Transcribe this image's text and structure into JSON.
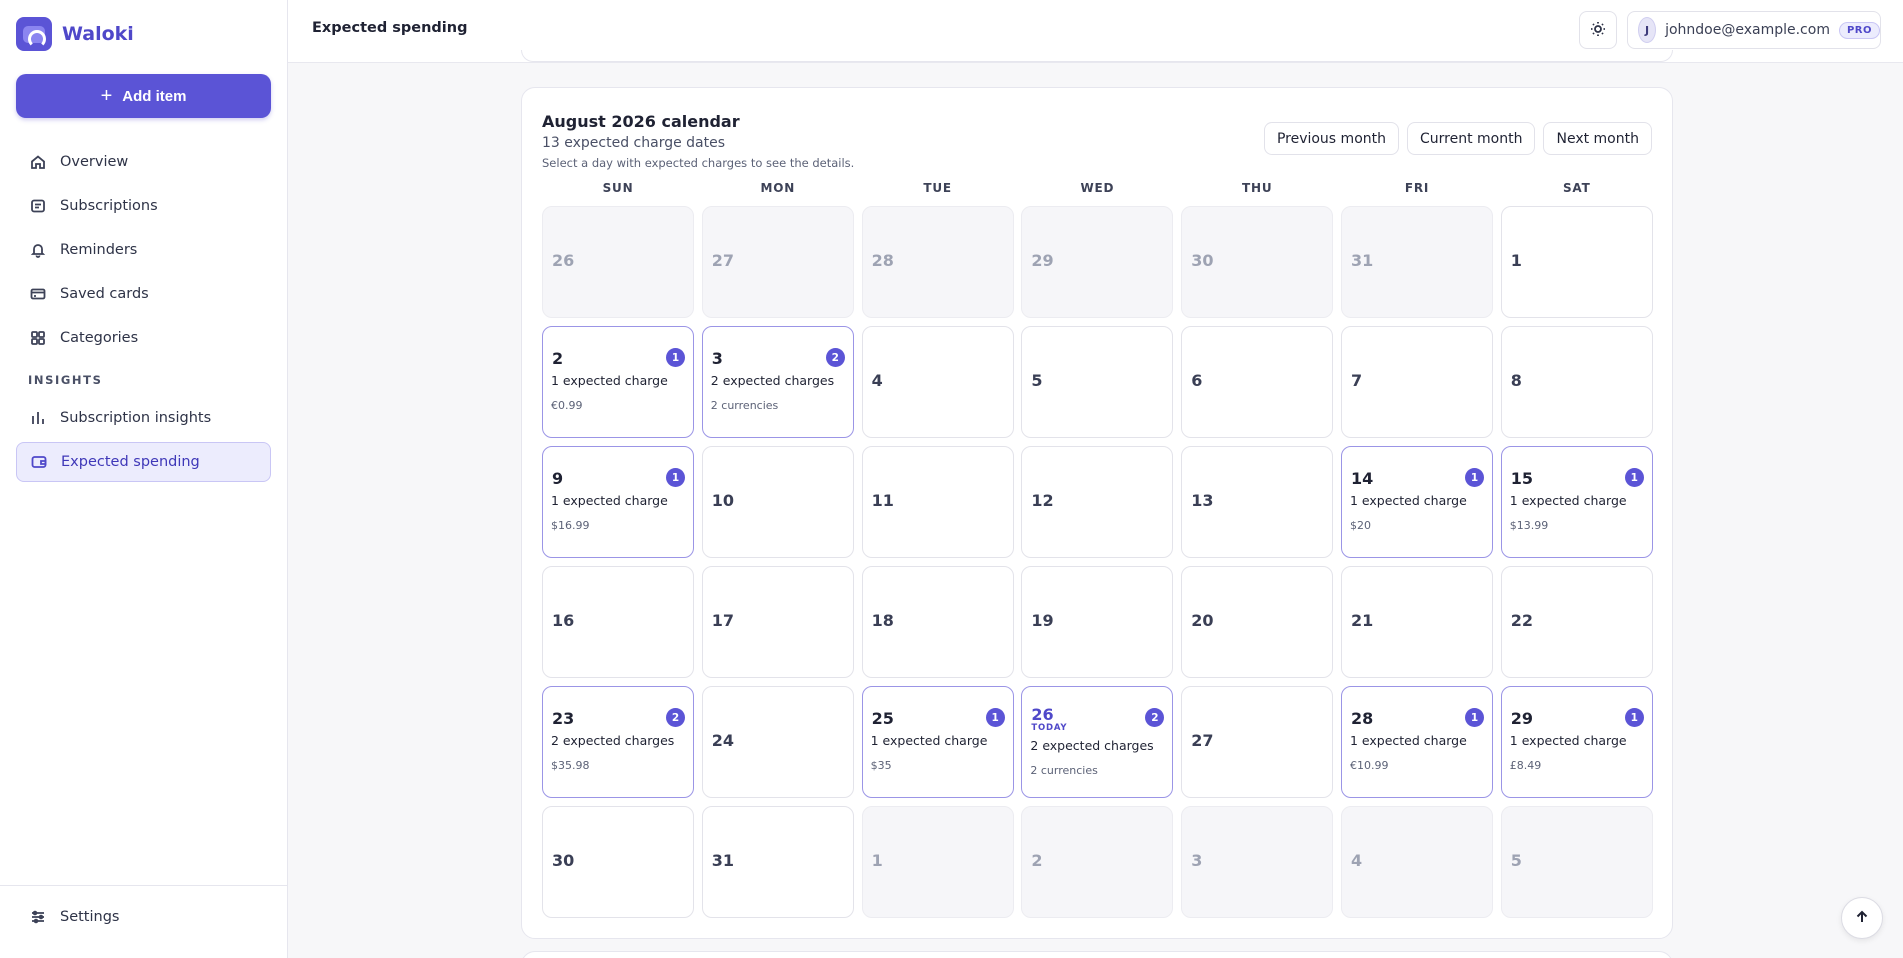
{
  "app": {
    "name": "Waloki"
  },
  "sidebar": {
    "add_label": "Add item",
    "items": [
      {
        "label": "Overview",
        "icon": "home-icon"
      },
      {
        "label": "Subscriptions",
        "icon": "list-icon"
      },
      {
        "label": "Reminders",
        "icon": "bell-icon"
      },
      {
        "label": "Saved cards",
        "icon": "card-icon"
      },
      {
        "label": "Categories",
        "icon": "grid-icon"
      }
    ],
    "section_label": "INSIGHTS",
    "insights": [
      {
        "label": "Subscription insights",
        "icon": "bar-chart-icon"
      },
      {
        "label": "Expected spending",
        "icon": "wallet-icon",
        "active": true
      }
    ],
    "settings_label": "Settings"
  },
  "header": {
    "title": "Expected spending",
    "user_initial": "J",
    "user_email": "johndoe@example.com",
    "plan_badge": "PRO"
  },
  "calendar": {
    "title": "August 2026 calendar",
    "subtitle": "13 expected charge dates",
    "hint": "Select a day with expected charges to see the details.",
    "buttons": {
      "previous": "Previous month",
      "current": "Current month",
      "next": "Next month"
    },
    "weekdays": [
      "SUN",
      "MON",
      "TUE",
      "WED",
      "THU",
      "FRI",
      "SAT"
    ],
    "today_label": "TODAY",
    "days": [
      {
        "day": "26",
        "outside": true
      },
      {
        "day": "27",
        "outside": true
      },
      {
        "day": "28",
        "outside": true
      },
      {
        "day": "29",
        "outside": true
      },
      {
        "day": "30",
        "outside": true
      },
      {
        "day": "31",
        "outside": true
      },
      {
        "day": "1"
      },
      {
        "day": "2",
        "count": "1",
        "charges": "1 expected charge",
        "amount": "€0.99"
      },
      {
        "day": "3",
        "count": "2",
        "charges": "2 expected charges",
        "amount": "2 currencies"
      },
      {
        "day": "4"
      },
      {
        "day": "5"
      },
      {
        "day": "6"
      },
      {
        "day": "7"
      },
      {
        "day": "8"
      },
      {
        "day": "9",
        "count": "1",
        "charges": "1 expected charge",
        "amount": "$16.99"
      },
      {
        "day": "10"
      },
      {
        "day": "11"
      },
      {
        "day": "12"
      },
      {
        "day": "13"
      },
      {
        "day": "14",
        "count": "1",
        "charges": "1 expected charge",
        "amount": "$20"
      },
      {
        "day": "15",
        "count": "1",
        "charges": "1 expected charge",
        "amount": "$13.99"
      },
      {
        "day": "16"
      },
      {
        "day": "17"
      },
      {
        "day": "18"
      },
      {
        "day": "19"
      },
      {
        "day": "20"
      },
      {
        "day": "21"
      },
      {
        "day": "22"
      },
      {
        "day": "23",
        "count": "2",
        "charges": "2 expected charges",
        "amount": "$35.98"
      },
      {
        "day": "24"
      },
      {
        "day": "25",
        "count": "1",
        "charges": "1 expected charge",
        "amount": "$35"
      },
      {
        "day": "26",
        "count": "2",
        "charges": "2 expected charges",
        "amount": "2 currencies",
        "today": true
      },
      {
        "day": "27"
      },
      {
        "day": "28",
        "count": "1",
        "charges": "1 expected charge",
        "amount": "€10.99"
      },
      {
        "day": "29",
        "count": "1",
        "charges": "1 expected charge",
        "amount": "£8.49"
      },
      {
        "day": "30"
      },
      {
        "day": "31"
      },
      {
        "day": "1",
        "outside": true
      },
      {
        "day": "2",
        "outside": true
      },
      {
        "day": "3",
        "outside": true
      },
      {
        "day": "4",
        "outside": true
      },
      {
        "day": "5",
        "outside": true
      }
    ]
  },
  "colors": {
    "accent": "#5b54d6",
    "active_bg": "#ececfd",
    "page_bg": "#f7f7f9"
  }
}
